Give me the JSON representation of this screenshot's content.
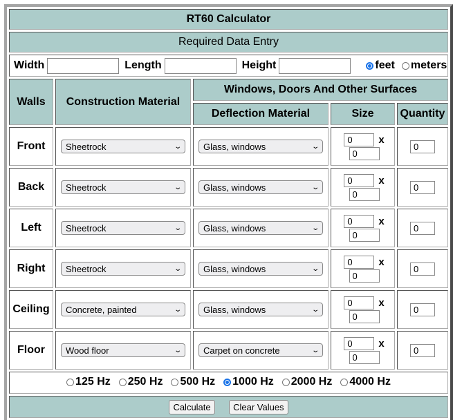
{
  "title": "RT60 Calculator",
  "subtitle": "Required Data Entry",
  "dimensions": {
    "width_label": "Width",
    "width_value": "",
    "length_label": "Length",
    "length_value": "",
    "height_label": "Height",
    "height_value": "",
    "units": [
      {
        "label": "feet",
        "selected": true
      },
      {
        "label": "meters",
        "selected": false
      }
    ]
  },
  "headers": {
    "walls": "Walls",
    "construction": "Construction Material",
    "surfaces": "Windows, Doors And Other Surfaces",
    "deflection": "Deflection Material",
    "size": "Size",
    "quantity": "Quantity",
    "size_separator": "x"
  },
  "rows": [
    {
      "wall": "Front",
      "construction": "Sheetrock",
      "deflection": "Glass, windows",
      "size_w": "0",
      "size_h": "0",
      "quantity": "0"
    },
    {
      "wall": "Back",
      "construction": "Sheetrock",
      "deflection": "Glass, windows",
      "size_w": "0",
      "size_h": "0",
      "quantity": "0"
    },
    {
      "wall": "Left",
      "construction": "Sheetrock",
      "deflection": "Glass, windows",
      "size_w": "0",
      "size_h": "0",
      "quantity": "0"
    },
    {
      "wall": "Right",
      "construction": "Sheetrock",
      "deflection": "Glass, windows",
      "size_w": "0",
      "size_h": "0",
      "quantity": "0"
    },
    {
      "wall": "Ceiling",
      "construction": "Concrete, painted",
      "deflection": "Glass, windows",
      "size_w": "0",
      "size_h": "0",
      "quantity": "0"
    },
    {
      "wall": "Floor",
      "construction": "Wood floor",
      "deflection": "Carpet on concrete",
      "size_w": "0",
      "size_h": "0",
      "quantity": "0"
    }
  ],
  "frequencies": [
    {
      "label": "125 Hz",
      "selected": false
    },
    {
      "label": "250 Hz",
      "selected": false
    },
    {
      "label": "500 Hz",
      "selected": false
    },
    {
      "label": "1000 Hz",
      "selected": true
    },
    {
      "label": "2000 Hz",
      "selected": false
    },
    {
      "label": "4000 Hz",
      "selected": false
    }
  ],
  "buttons": {
    "calculate": "Calculate",
    "clear": "Clear Values"
  },
  "colors": {
    "header_bg": "#acccca",
    "radio_selected": "#1a73e8"
  }
}
